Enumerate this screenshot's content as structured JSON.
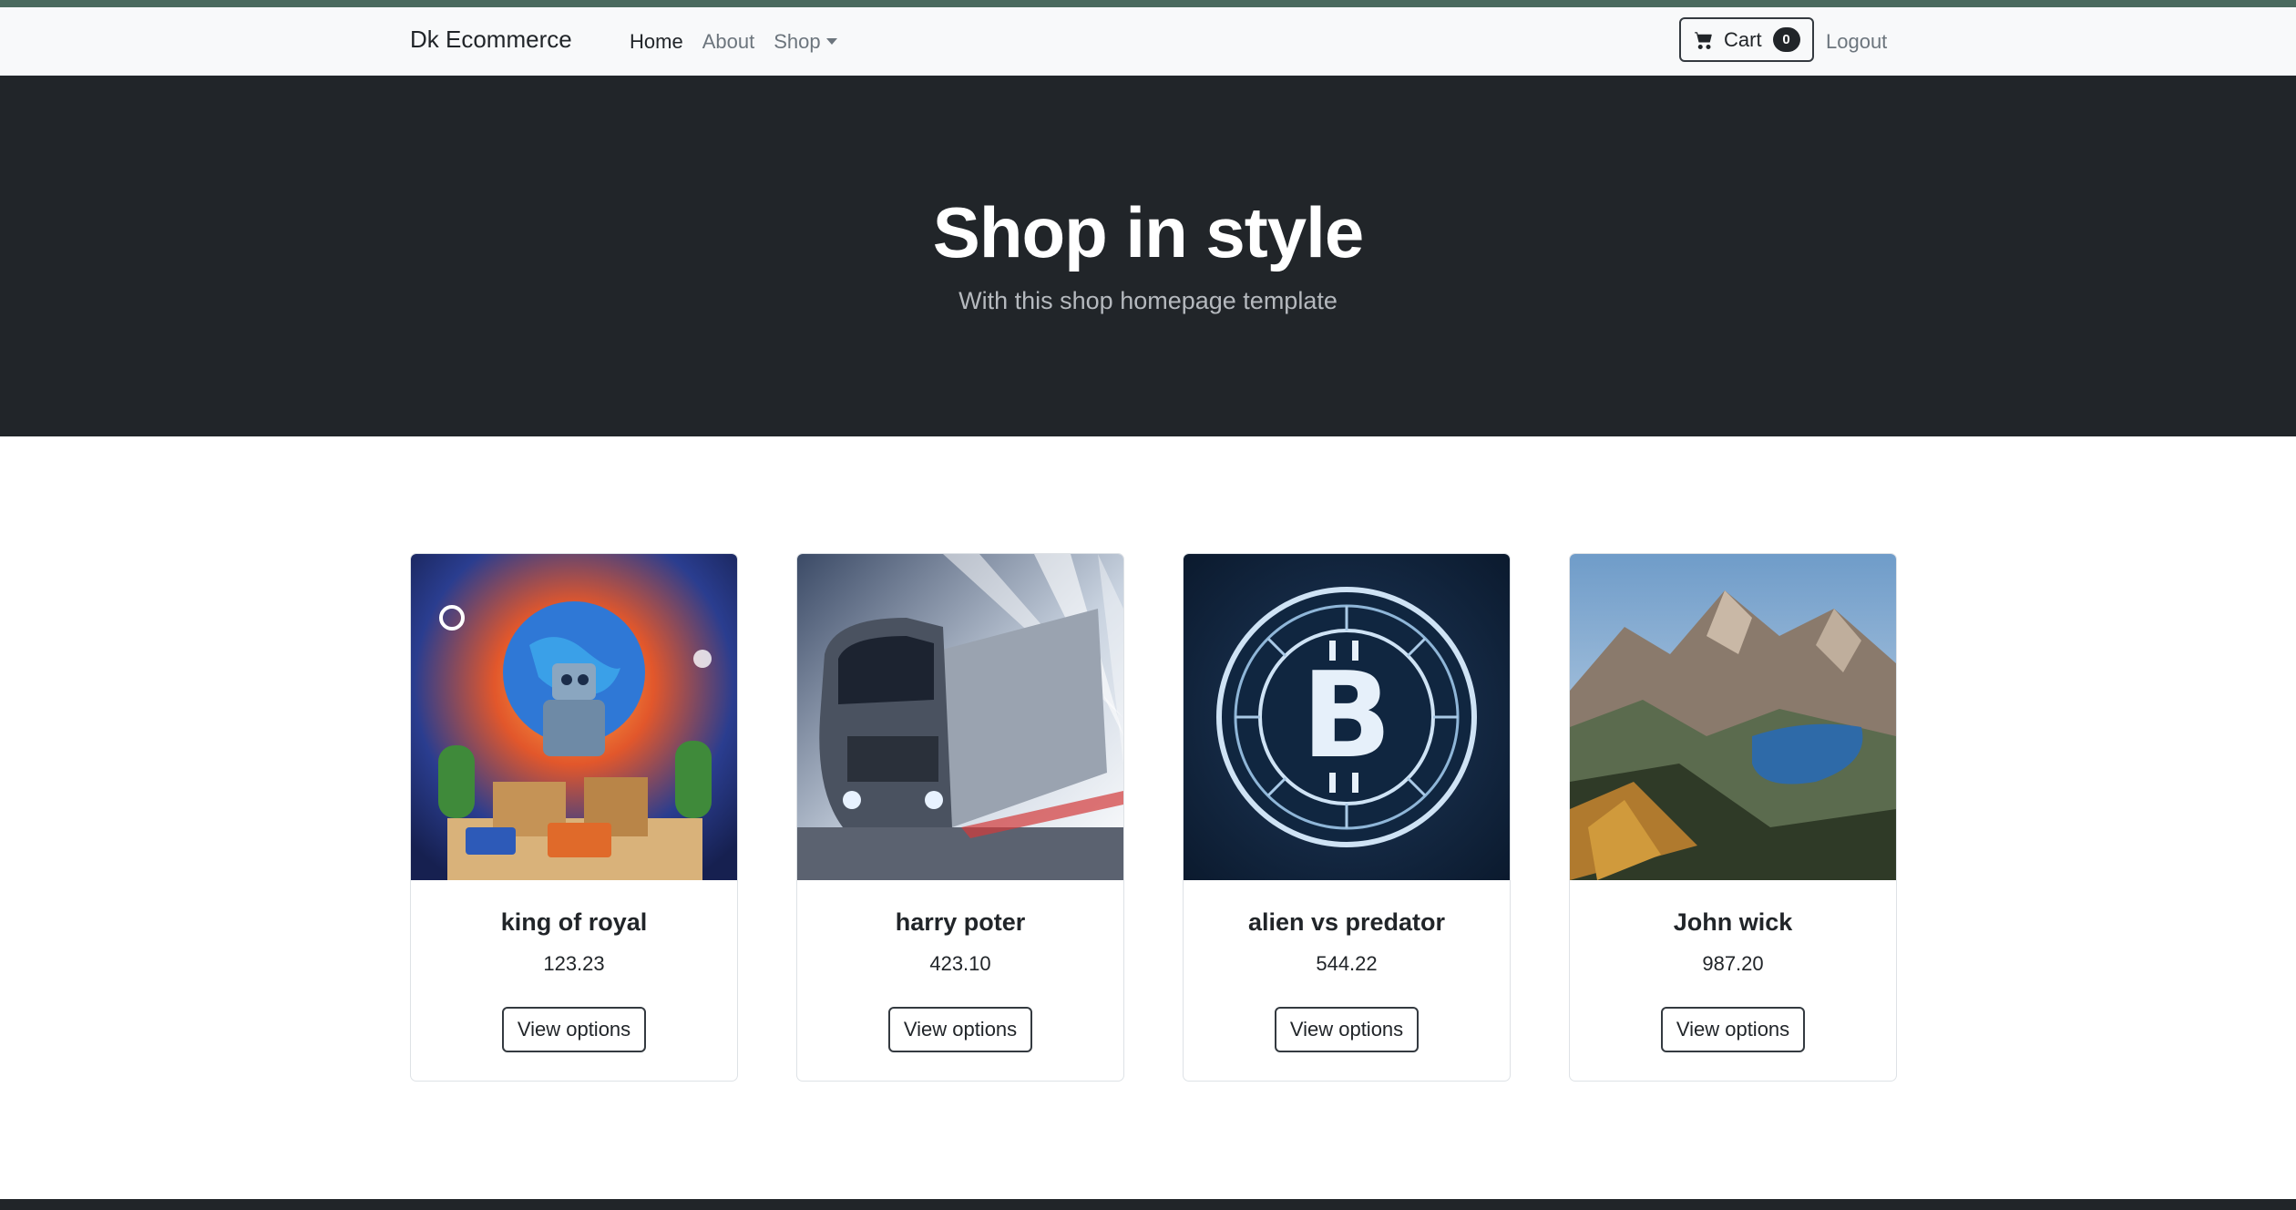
{
  "navbar": {
    "brand": "Dk Ecommerce",
    "links": [
      {
        "label": "Home"
      },
      {
        "label": "About"
      },
      {
        "label": "Shop"
      }
    ],
    "cart": {
      "label": "Cart",
      "count": "0"
    },
    "logout": "Logout"
  },
  "hero": {
    "title": "Shop in style",
    "subtitle": "With this shop homepage template"
  },
  "products": [
    {
      "name": "king of royal",
      "price": "123.23",
      "button": "View options",
      "image": "ecommerce-globe-robot-illustration"
    },
    {
      "name": "harry poter",
      "price": "423.10",
      "button": "View options",
      "image": "speeding-truck-photo"
    },
    {
      "name": "alien vs predator",
      "price": "544.22",
      "button": "View options",
      "image": "bitcoin-coin-illustration"
    },
    {
      "name": "John wick",
      "price": "987.20",
      "button": "View options",
      "image": "mountain-lake-landscape-photo"
    }
  ],
  "colors": {
    "hero_bg": "#212529",
    "navbar_bg": "#f8f9fa",
    "accent_top": "#4a6a5e"
  }
}
